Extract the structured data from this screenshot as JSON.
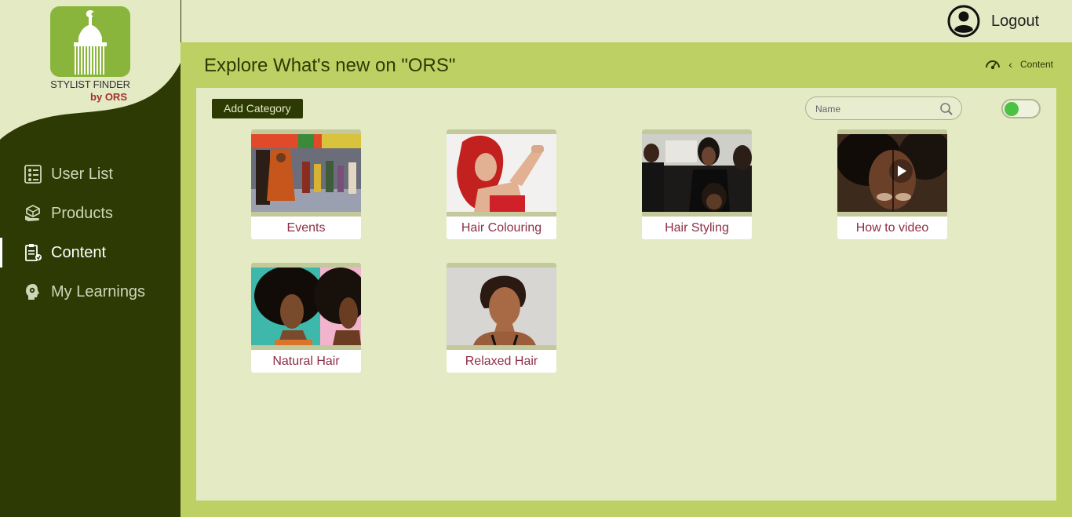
{
  "logo": {
    "line1": "STYLIST FINDER",
    "line2": "by ORS"
  },
  "nav": [
    {
      "label": "User List",
      "icon": "user-list-icon",
      "active": false
    },
    {
      "label": "Products",
      "icon": "products-icon",
      "active": false
    },
    {
      "label": "Content",
      "icon": "content-icon",
      "active": true
    },
    {
      "label": "My Learnings",
      "icon": "learnings-icon",
      "active": false
    }
  ],
  "topbar": {
    "logout_label": "Logout"
  },
  "header": {
    "title": "Explore What's new on \"ORS\"",
    "breadcrumb": "Content"
  },
  "toolbar": {
    "add_category_label": "Add Category",
    "search_placeholder": "Name",
    "toggle_on": true
  },
  "categories": [
    {
      "label": "Events"
    },
    {
      "label": "Hair Colouring"
    },
    {
      "label": "Hair Styling"
    },
    {
      "label": "How to video"
    },
    {
      "label": "Natural Hair"
    },
    {
      "label": "Relaxed Hair"
    }
  ],
  "colors": {
    "sidebar": "#2d3a03",
    "band": "#bdd063",
    "panel": "#e3eac4",
    "caption": "#8e2d45",
    "toggle_knob": "#4cc244"
  }
}
